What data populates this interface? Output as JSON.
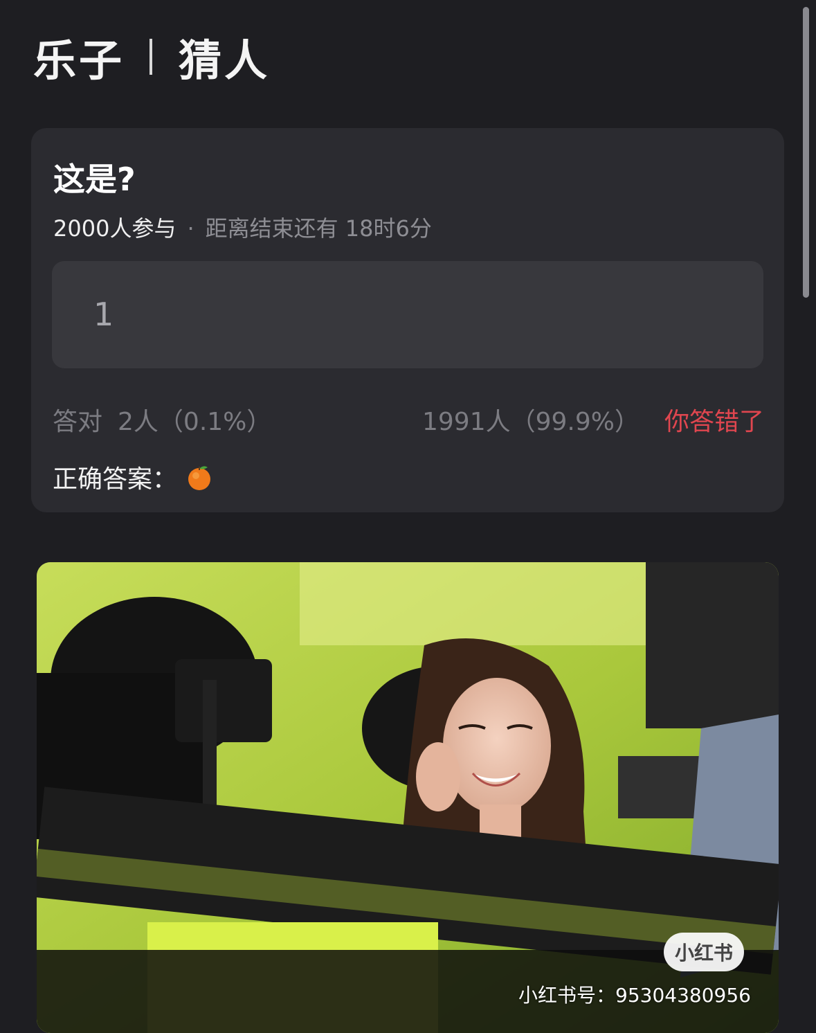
{
  "header": {
    "left_title": "乐子",
    "right_title": "猜人"
  },
  "quiz": {
    "question": "这是?",
    "participants": "2000人参与",
    "separator": "·",
    "countdown": "距离结束还有 18时6分",
    "my_answer": "1",
    "correct_label": "答对",
    "correct_count": "2人（0.1%）",
    "wrong_count": "1991人（99.9%）",
    "result_label": "你答错了",
    "answer_label": "正确答案："
  },
  "photo": {
    "badge_text": "小红书",
    "id_text": "小红书号：95304380956"
  },
  "colors": {
    "background": "#1e1e22",
    "card": "#2b2b30",
    "wrong_red": "#e0464f",
    "muted_text": "#7c7c82"
  },
  "icons": {
    "answer_emoji": "orange-icon"
  }
}
